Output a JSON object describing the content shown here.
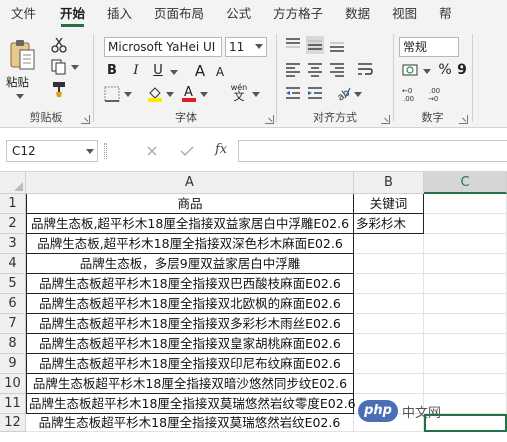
{
  "ribbon_tabs": [
    "文件",
    "开始",
    "插入",
    "页面布局",
    "公式",
    "方方格子",
    "数据",
    "视图",
    "帮"
  ],
  "clipboard": {
    "paste_label": "粘贴",
    "group_label": "剪贴板"
  },
  "font": {
    "name": "Microsoft YaHei UI",
    "size": "11",
    "group_label": "字体",
    "bold": "B",
    "italic": "I",
    "underline": "U",
    "grow": "A",
    "shrink": "A",
    "wen": "wén",
    "phonetic": "文"
  },
  "alignment": {
    "group_label": "对齐方式"
  },
  "number": {
    "format": "常规",
    "group_label": "数字",
    "percent": "%",
    "comma": "9"
  },
  "formula_bar": {
    "name_box": "C12",
    "fx": "fx"
  },
  "columns": [
    "A",
    "B",
    "C"
  ],
  "rows": [
    "1",
    "2",
    "3",
    "4",
    "5",
    "6",
    "7",
    "8",
    "9",
    "10",
    "11",
    "12"
  ],
  "cells": {
    "A1": "商品",
    "B1": "关键词",
    "A2": "品牌生态板,超平杉木18厘全指接双益家居白中浮雕E02.6",
    "B2": "多彩杉木",
    "A3": "品牌生态板,超平杉木18厘全指接双深色杉木麻面E02.6",
    "A4": "品牌生态板，多层9厘双益家居白中浮雕",
    "A5": "品牌生态板超平杉木18厘全指接双巴西酸枝麻面E02.6",
    "A6": "品牌生态板超平杉木18厘全指接双北欧枫的麻面E02.6",
    "A7": "品牌生态板超平杉木18厘全指接双多彩杉木雨丝E02.6",
    "A8": "品牌生态板超平杉木18厘全指接双皇家胡桃麻面E02.6",
    "A9": "品牌生态板超平杉木18厘全指接双印尼布纹麻面E02.6",
    "A10": "品牌生态板超平杉木18厘全指接双暗沙悠然同步纹E02.6",
    "A11": "品牌生态板超平杉木18厘全指接双莫瑞悠然岩纹零度E02.6",
    "A12": "品牌生态板超平杉木18厘全指接双莫瑞悠然岩纹E02.6"
  },
  "watermark": {
    "text": "php",
    "suffix": "中文网"
  },
  "colors": {
    "accent": "#217346",
    "watermark_bg": "#4a6fb5"
  }
}
